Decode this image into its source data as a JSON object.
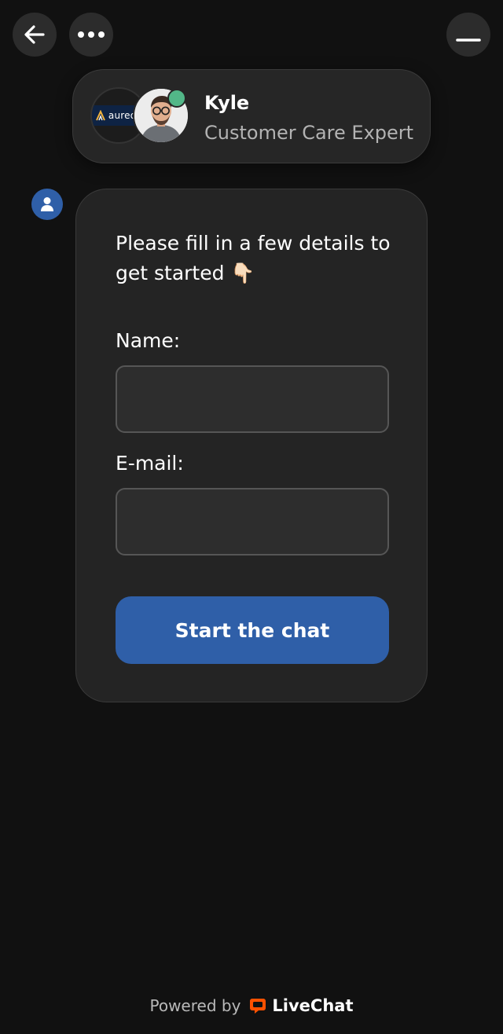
{
  "topbar": {
    "back_icon": "arrow-left-icon",
    "more_icon": "ellipsis-icon",
    "minimize_icon": "minimize-icon"
  },
  "agent": {
    "name": "Kyle",
    "role": "Customer Care Expert",
    "logo_text": "aureon",
    "status_color": "#52b788"
  },
  "form": {
    "intro": "Please fill in a few details to get started 👇🏻",
    "name_label": "Name:",
    "name_value": "",
    "email_label": "E-mail:",
    "email_value": "",
    "submit_label": "Start the chat"
  },
  "footer": {
    "powered_by": "Powered by",
    "brand": "LiveChat",
    "brand_color": "#ff5100"
  },
  "colors": {
    "background": "#111111",
    "card": "#242424",
    "accent": "#2f5fa8"
  }
}
